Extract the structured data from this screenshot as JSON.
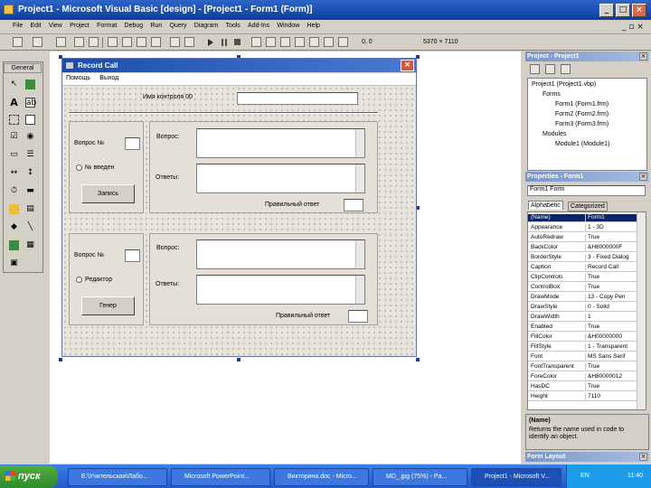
{
  "window": {
    "title": "Project1 - Microsoft Visual Basic [design] - [Project1 - Form1 (Form)]"
  },
  "menu": [
    "File",
    "Edit",
    "View",
    "Project",
    "Format",
    "Debug",
    "Run",
    "Query",
    "Diagram",
    "Tools",
    "Add-Ins",
    "Window",
    "Help"
  ],
  "toolbar": {
    "position": "0, 0",
    "size": "5370 × 7110"
  },
  "toolbox": {
    "title": "General"
  },
  "form": {
    "caption": "Record Call",
    "menu": [
      "Помощь",
      "Выход"
    ],
    "top_label": "Имя контроля 00",
    "section1": {
      "question_label": "Вопрос №",
      "radio_label": "№ введен",
      "button": "Запись",
      "q_text_label": "Вопрос:",
      "a_text_label": "Ответы:",
      "right_label": "Правильный ответ"
    },
    "section2": {
      "question_label": "Вопрос №",
      "radio_label": "Редактор",
      "button": "Генер",
      "q_text_label": "Вопрос:",
      "a_text_label": "Ответы:",
      "right_label": "Правильный ответ"
    }
  },
  "project": {
    "title": "Project - Project1",
    "nodes": [
      "Project1 (Project1.vbp)",
      "Forms",
      "Form1 (Form1.frm)",
      "Form2 (Form2.frm)",
      "Form3 (Form3.frm)",
      "Modules",
      "Module1 (Module1)"
    ]
  },
  "properties": {
    "title": "Properties - Form1",
    "object": "Form1  Form",
    "tabs": [
      "Alphabetic",
      "Categorized"
    ],
    "rows": [
      {
        "k": "(Name)",
        "v": "Form1"
      },
      {
        "k": "Appearance",
        "v": "1 - 3D"
      },
      {
        "k": "AutoRedraw",
        "v": "True"
      },
      {
        "k": "BackColor",
        "v": "&H8000000F"
      },
      {
        "k": "BorderStyle",
        "v": "3 - Fixed Dialog"
      },
      {
        "k": "Caption",
        "v": "Record Call"
      },
      {
        "k": "ClipControls",
        "v": "True"
      },
      {
        "k": "ControlBox",
        "v": "True"
      },
      {
        "k": "DrawMode",
        "v": "13 - Copy Pen"
      },
      {
        "k": "DrawStyle",
        "v": "0 - Solid"
      },
      {
        "k": "DrawWidth",
        "v": "1"
      },
      {
        "k": "Enabled",
        "v": "True"
      },
      {
        "k": "FillColor",
        "v": "&H00000000"
      },
      {
        "k": "FillStyle",
        "v": "1 - Transparent"
      },
      {
        "k": "Font",
        "v": "MS Sans Serif"
      },
      {
        "k": "FontTransparent",
        "v": "True"
      },
      {
        "k": "ForeColor",
        "v": "&H80000012"
      },
      {
        "k": "HasDC",
        "v": "True"
      },
      {
        "k": "Height",
        "v": "7110"
      }
    ],
    "desc_title": "(Name)",
    "desc_text": "Returns the name used in code to identify an object."
  },
  "form_layout": {
    "title": "Form Layout"
  },
  "taskbar": {
    "start": "пуск",
    "tasks": [
      "E:\\Учительская\\Лабо...",
      "Microsoft PowerPoint...",
      "Викторина.doc - Micro...",
      "MD_.jpg (75%) - Pa...",
      "Project1 - Microsoft V..."
    ],
    "lang": "EN",
    "clock": "11:40"
  }
}
